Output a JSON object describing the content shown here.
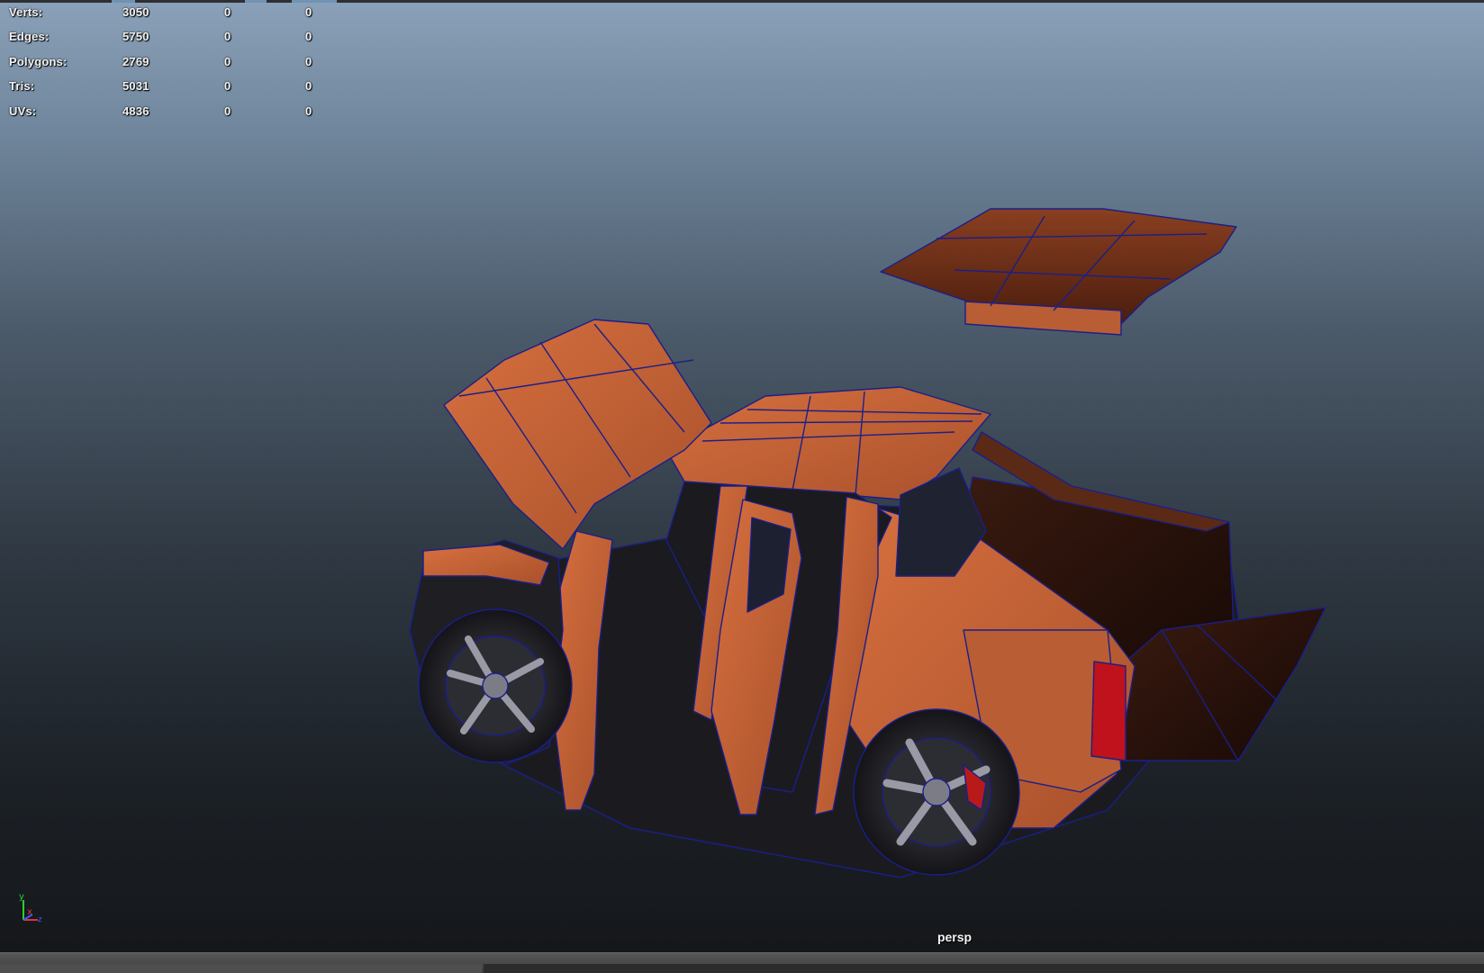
{
  "stats": [
    {
      "label": "Verts:",
      "v1": "3050",
      "v2": "0",
      "v3": "0"
    },
    {
      "label": "Edges:",
      "v1": "5750",
      "v2": "0",
      "v3": "0"
    },
    {
      "label": "Polygons:",
      "v1": "2769",
      "v2": "0",
      "v3": "0"
    },
    {
      "label": "Tris:",
      "v1": "5031",
      "v2": "0",
      "v3": "0"
    },
    {
      "label": "UVs:",
      "v1": "4836",
      "v2": "0",
      "v3": "0"
    }
  ],
  "viewport": {
    "camera_label": "persp",
    "axis": {
      "y": "y",
      "x": "x",
      "z": "z"
    }
  },
  "colors": {
    "body": "#c8643a",
    "wire": "#1a1f8a",
    "shadow": "#1c1a1d",
    "rim": "#6c6c74"
  }
}
